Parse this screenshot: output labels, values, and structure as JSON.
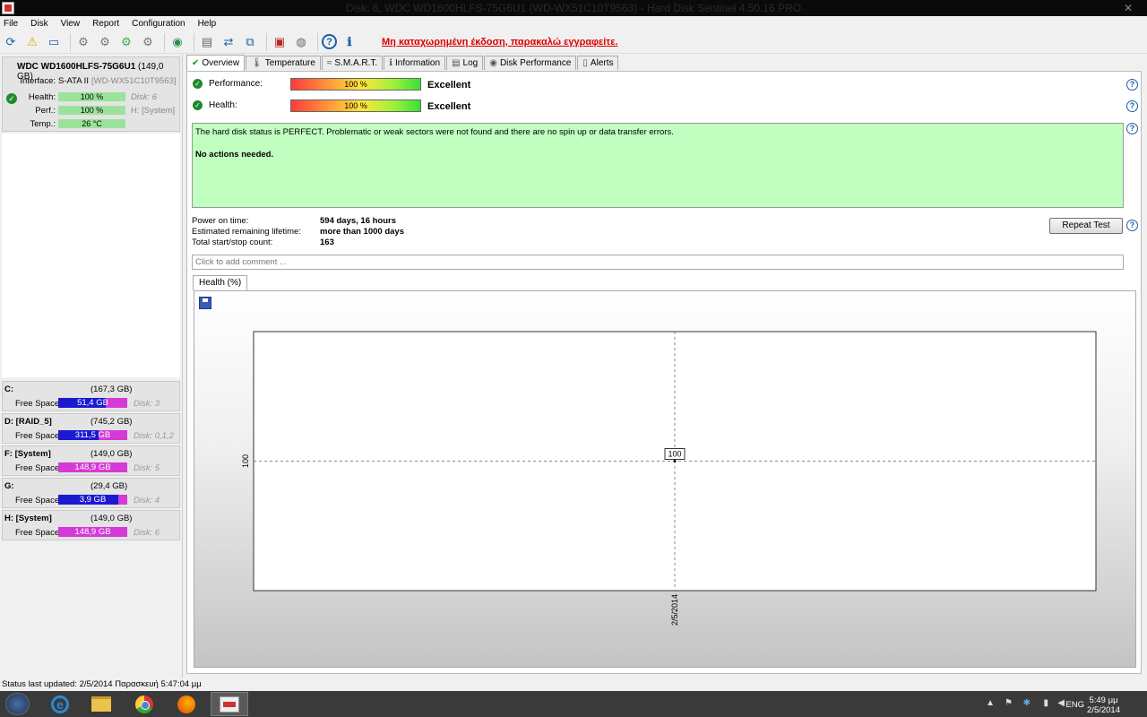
{
  "window": {
    "title": "Disk: 6, WDC WD1600HLFS-75G6U1 (WD-WX51C10T9563) - Hard Disk Sentinel 4.50.16 PRO"
  },
  "menu": [
    "File",
    "Disk",
    "View",
    "Report",
    "Configuration",
    "Help"
  ],
  "toolbar": {
    "register_link": "Μη καταχωρημένη έκδοση, παρακαλώ εγγραφείτε."
  },
  "disk": {
    "name": "WDC WD1600HLFS-75G6U1",
    "size": "(149,0 GB)",
    "interface_label": "Interface:",
    "interface": "S-ATA II",
    "serial": "[WD-WX51C10T9563]",
    "health_label": "Health:",
    "health_value": "100 %",
    "health_fraction": 1.0,
    "disk_num": "Disk: 6",
    "perf_label": "Perf.:",
    "perf_value": "100 %",
    "perf_fraction": 1.0,
    "volume": "H: [System]",
    "temp_label": "Temp.:",
    "temp_value": "26 °C"
  },
  "drives": [
    {
      "letter": "C:",
      "size": "(167,3 GB)",
      "free_label": "Free Space",
      "free": "51,4 GB",
      "used_fraction": 0.69,
      "disk": "Disk: 3"
    },
    {
      "letter": "D: [RAID_5]",
      "size": "(745,2 GB)",
      "free_label": "Free Space",
      "free": "311,5 GB",
      "used_fraction": 0.58,
      "disk": "Disk: 0,1,2"
    },
    {
      "letter": "F: [System]",
      "size": "(149,0 GB)",
      "free_label": "Free Space",
      "free": "148,9 GB",
      "used_fraction": 0.0,
      "disk": "Disk: 5"
    },
    {
      "letter": "G:",
      "size": "(29,4 GB)",
      "free_label": "Free Space",
      "free": "3,9 GB",
      "used_fraction": 0.87,
      "disk": "Disk: 4"
    },
    {
      "letter": "H: [System]",
      "size": "(149,0 GB)",
      "free_label": "Free Space",
      "free": "148,9 GB",
      "used_fraction": 0.0,
      "disk": "Disk: 6"
    }
  ],
  "tabs": [
    {
      "label": "Overview",
      "icon": "check-icon",
      "active": true
    },
    {
      "label": "Temperature",
      "icon": "thermometer-icon"
    },
    {
      "label": "S.M.A.R.T.",
      "icon": "smart-icon"
    },
    {
      "label": "Information",
      "icon": "info-icon"
    },
    {
      "label": "Log",
      "icon": "log-icon"
    },
    {
      "label": "Disk Performance",
      "icon": "performance-icon"
    },
    {
      "label": "Alerts",
      "icon": "alerts-icon"
    }
  ],
  "overview": {
    "performance_label": "Performance:",
    "performance_value": "100 %",
    "performance_word": "Excellent",
    "health_label": "Health:",
    "health_value": "100 %",
    "health_word": "Excellent",
    "status_text": "The hard disk status is PERFECT. Problematic or weak sectors were not found and there are no spin up or data transfer errors.",
    "status_action": "No actions needed.",
    "power_on_label": "Power on time:",
    "power_on_value": "594 days, 16 hours",
    "lifetime_label": "Estimated remaining lifetime:",
    "lifetime_value": "more than 1000 days",
    "startstop_label": "Total start/stop count:",
    "startstop_value": "163",
    "repeat_button": "Repeat Test",
    "comment_placeholder": "Click to add comment ...",
    "chart_tab": "Health (%)"
  },
  "chart_data": {
    "type": "line",
    "x": [
      "2/5/2014"
    ],
    "series": [
      {
        "values": [
          100
        ]
      }
    ],
    "data_labels": [
      "100"
    ],
    "y_ticks": [
      "100"
    ],
    "x_ticks": [
      "2/5/2014"
    ]
  },
  "statusbar": {
    "text": "Status last updated: 2/5/2014 Παρασκευή 5:47:04 μμ"
  },
  "taskbar": {
    "lang": "ENG",
    "time": "5:49 μμ",
    "date": "2/5/2014"
  },
  "colors": {
    "ok_green": "#1f8a2c",
    "status_bg": "#c0ffc0",
    "free_magenta": "#d33ad6",
    "used_blue": "#1a1ad0",
    "warning_red": "#dd0000"
  }
}
